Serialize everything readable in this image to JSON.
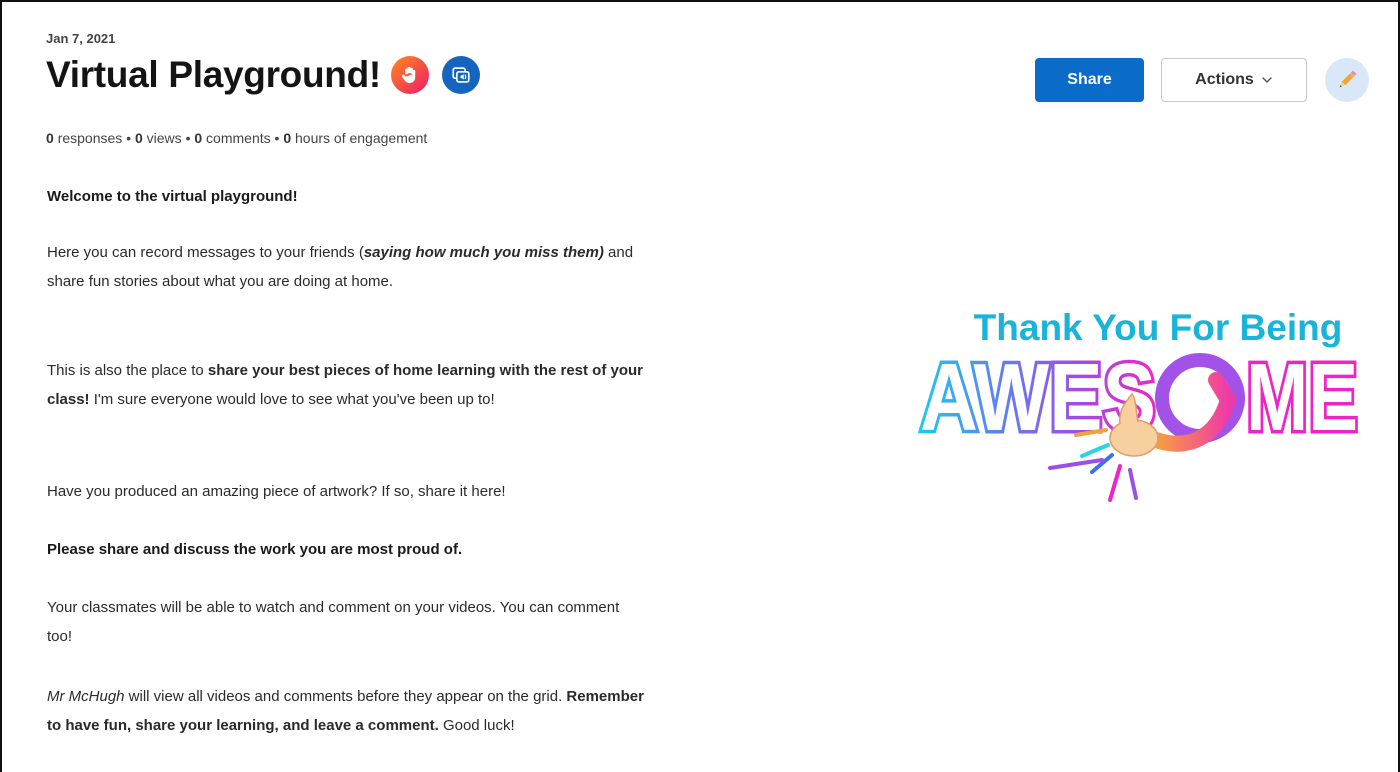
{
  "post": {
    "date": "Jan 7, 2021",
    "title": "Virtual Playground!",
    "stats": {
      "responses_count": "0",
      "responses_label": "responses",
      "views_count": "0",
      "views_label": "views",
      "comments_count": "0",
      "comments_label": "comments",
      "hours_count": "0",
      "hours_label": "hours of engagement",
      "separator": "•"
    }
  },
  "toolbar": {
    "share_label": "Share",
    "actions_label": "Actions"
  },
  "body": {
    "p1": "Welcome to the virtual playground!",
    "p2_a": "Here you can record messages to your friends (",
    "p2_b": "saying how much you miss them)",
    "p2_c": " and share fun stories about what you are doing at home.",
    "p3_a": "This is also the place to ",
    "p3_b": "share your best pieces of home learning with the rest of your class!",
    "p3_c": " I'm sure everyone would love to see what you've been up to!",
    "p4": "Have you produced an amazing piece of artwork? If so, share it here!",
    "p5": "Please share and discuss the work you are most proud of.",
    "p6": "Your classmates will be able to watch and comment on your videos. You can comment too!",
    "p7_a": "Mr McHugh",
    "p7_b": " will view all videos and comments before they appear on the grid. ",
    "p7_c": "Remember to have fun, share your learning, and leave a comment.",
    "p7_d": " Good luck!"
  },
  "cover_image": {
    "line1": "Thank You For Being",
    "line2_a": "AWES",
    "line2_b": "ME"
  },
  "icons": {
    "hand": "hand-raise-icon",
    "caption": "closed-captions-icon",
    "chevron": "chevron-down-icon",
    "edit": "pencil-icon"
  },
  "colors": {
    "primary": "#0a6bc9",
    "hand_badge_start": "#ff8a1f",
    "hand_badge_end": "#f0196b",
    "caption_badge": "#1565c0",
    "edit_bg": "#d8e8f8",
    "logo_top_text": "#19b4d8"
  }
}
